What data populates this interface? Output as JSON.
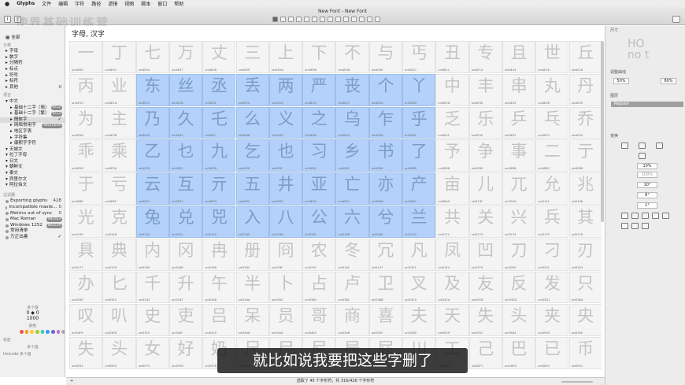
{
  "menubar": {
    "app": "Glyphs",
    "items": [
      "文件",
      "编辑",
      "字符",
      "路径",
      "滤镜",
      "视图",
      "脚本",
      "窗口",
      "帮助"
    ]
  },
  "window": {
    "title": "New Font - New Font"
  },
  "watermark": "使界基础训练营",
  "sidebar": {
    "all": "全部",
    "category_header": "分类",
    "categories": [
      {
        "label": "字母"
      },
      {
        "label": "数字"
      },
      {
        "label": "分隔符"
      },
      {
        "label": "标点"
      },
      {
        "label": "符号"
      },
      {
        "label": "标符"
      },
      {
        "label": "其他",
        "count": "0"
      }
    ],
    "language_header": "语言",
    "languages": [
      {
        "label": "中文",
        "indent": 0
      },
      {
        "label": "基础十二字（简）",
        "indent": 1,
        "count": "4/12"
      },
      {
        "label": "基础十二字（繁）",
        "indent": 1,
        "count": "0/12"
      },
      {
        "label": "簡体字",
        "indent": 1,
        "check": "✓",
        "selected": true
      },
      {
        "label": "网络常用字",
        "indent": 1,
        "count": "36/21656"
      },
      {
        "label": "地区字表",
        "indent": 1
      },
      {
        "label": "字符集",
        "indent": 1
      },
      {
        "label": "康熙字字符",
        "indent": 1
      },
      {
        "label": "天城文",
        "indent": 0
      },
      {
        "label": "拉丁字母",
        "indent": 0
      },
      {
        "label": "日文",
        "indent": 0
      },
      {
        "label": "朝鲜文",
        "indent": 0
      },
      {
        "label": "泰文",
        "indent": 0
      },
      {
        "label": "西里尔文",
        "indent": 0
      },
      {
        "label": "阿拉伯文",
        "indent": 0
      }
    ],
    "filter_header": "过滤器",
    "filters": [
      {
        "label": "Exporting glyphs",
        "value": "428"
      },
      {
        "label": "Incompatible maste...",
        "value": "0"
      },
      {
        "label": "Metrics out of sync",
        "value": "0"
      },
      {
        "label": "Mac Roman",
        "count": "94/243"
      },
      {
        "label": "Windows 1252",
        "count": "86/216"
      },
      {
        "label": "常用清单",
        "value": ""
      },
      {
        "label": "万正出書",
        "check": "✓"
      }
    ],
    "bottom": {
      "layers_label": "多个值",
      "value_a": "0",
      "value_b": "0",
      "width_value": "1000",
      "color_label": "颜色",
      "tags_label": "标签",
      "tags_value": "多个值",
      "unicode_label": "Unicode",
      "unicode_value": "多个值",
      "swatch_colors": [
        "#e55",
        "#f90",
        "#fc3",
        "#9c3",
        "#3c9",
        "#39f",
        "#66c",
        "#c6c",
        "#aaa"
      ]
    }
  },
  "main": {
    "title": "字母, 汉字",
    "rows": [
      {
        "glyphs": "一丁七万丈三上下不与丐丑专且世丘",
        "names": [
          "uni4E00",
          "uni4E01",
          "uni4E03",
          "uni4E07",
          "uni4E08",
          "uni4E09",
          "uni4E0A",
          "uni4E0B",
          "uni4E0D",
          "uni4E0E",
          "uni4E10",
          "uni4E11",
          "uni4E13",
          "uni4E14",
          "uni4E16",
          "uni4E18"
        ],
        "sel": []
      },
      {
        "glyphs": "丙业东丝丞丢两严丧个丫中丰串丸丹",
        "names": [
          "uni4E19",
          "uni4E1A",
          "uni4E1C",
          "uni4E1D",
          "uni4E1E",
          "uni4E22",
          "uni4E24",
          "uni4E25",
          "uni4E27",
          "uni4E2A",
          "uni4E2B",
          "uni4E2D",
          "uni4E30",
          "uni4E32",
          "uni4E38",
          "uni4E39"
        ],
        "sel": [
          2,
          3,
          4,
          5,
          6,
          7,
          8,
          9,
          10
        ]
      },
      {
        "glyphs": "为主乃久乇么义之乌乍乎乏乐乒乓乔",
        "names": [
          "uni4E3A",
          "uni4E3B",
          "uni4E43",
          "uni4E45",
          "uni4E47",
          "uni4E48",
          "uni4E49",
          "uni4E4B",
          "uni4E4C",
          "uni4E4D",
          "uni4E4E",
          "uni4E4F",
          "uni4E50",
          "uni4E52",
          "uni4E53",
          "uni4E54"
        ],
        "sel": [
          2,
          3,
          4,
          5,
          6,
          7,
          8,
          9,
          10
        ]
      },
      {
        "glyphs": "乖乘乙乜九乞也习乡书了予争事二亍",
        "names": [
          "uni4E56",
          "uni4E58",
          "uni4E59",
          "uni4E5C",
          "uni4E5D",
          "uni4E5E",
          "uni4E5F",
          "uni4E60",
          "uni4E61",
          "uni4E66",
          "uni4E86",
          "uni4E88",
          "uni4E89",
          "uni4E8B",
          "uni4E8C",
          "uni4E8D"
        ],
        "sel": [
          2,
          3,
          4,
          5,
          6,
          7,
          8,
          9,
          10
        ]
      },
      {
        "glyphs": "于亏云互亓五井亚亡亦产亩儿兀允兆",
        "names": [
          "uni4E8E",
          "uni4E8F",
          "uni4E91",
          "uni4E92",
          "uni4E93",
          "uni4E94",
          "uni4E95",
          "uni4E9A",
          "uni4EA1",
          "uni4EA6",
          "uni4EA7",
          "uni4EA9",
          "uni513F",
          "uni5140",
          "uni5141",
          "uni5146"
        ],
        "sel": [
          2,
          3,
          4,
          5,
          6,
          7,
          8,
          9,
          10
        ]
      },
      {
        "glyphs": "光克兔兑兕入八公六兮兰共关兴兵其",
        "names": [
          "uni5149",
          "uni514B",
          "uni5154",
          "uni5151",
          "uni5155",
          "uni5165",
          "uni516B",
          "uni516C",
          "uni516D",
          "uni516E",
          "uni5170",
          "uni5171",
          "uni5173",
          "uni5174",
          "uni5175",
          "uni5176"
        ],
        "sel": [
          2,
          3,
          4,
          5,
          6,
          7,
          8,
          9,
          10
        ]
      },
      {
        "glyphs": "具典内冈冉册冏农冬冗凡凤凹刀刁刃",
        "names": [
          "uni5177",
          "uni5178",
          "uni5185",
          "uni5188",
          "uni5189",
          "uni518C",
          "uni518F",
          "uni519C",
          "uni51AC",
          "uni5197",
          "uni51E1",
          "uni51E4",
          "uni51F9",
          "uni5200",
          "uni5201",
          "uni5203"
        ],
        "sel": []
      },
      {
        "glyphs": "办匕千升午半卜占卢卫叉及友反发只",
        "names": [
          "uni529E",
          "uni5315",
          "uni5343",
          "uni5347",
          "uni5348",
          "uni534A",
          "uni535C",
          "uni5360",
          "uni5362",
          "uni536B",
          "uni53C9",
          "uni53CA",
          "uni53CB",
          "uni53CD",
          "uni53D1",
          "uni53EA"
        ],
        "sel": []
      },
      {
        "glyphs": "叹叭史吏吕呆员哥商喜夫天失头夹央",
        "names": [
          "uni53F9",
          "uni53ED",
          "uni53F2",
          "uni540F",
          "uni5415",
          "uni5446",
          "uni5458",
          "uni54E5",
          "uni5546",
          "uni559C",
          "uni592B",
          "uni5929",
          "uni5931",
          "uni5934",
          "uni5939",
          "uni592E"
        ],
        "sel": []
      },
      {
        "glyphs": "失头女好奶尺尸尼局屁川工己巴已币",
        "names": [
          "uni5931",
          "uni5934",
          "uni5973",
          "uni597D",
          "uni5976",
          "uni5C3A",
          "uni5C38",
          "uni5C3C",
          "uni5C40",
          "uni5C41",
          "uni5DDD",
          "uni5DE5",
          "uni5DF1",
          "uni5DF4",
          "uni5DF2",
          "uni5E01"
        ],
        "sel": []
      }
    ]
  },
  "status": {
    "text": "选取了 45 个字形符，共 316/426 个字形符",
    "plus": "+"
  },
  "inspector": {
    "size_label": "尺寸",
    "preview_line1": "HO",
    "preview_line2": "no  t",
    "metrics_label": "调整曲线",
    "metric_left": "50%",
    "metric_right": "80%",
    "master_label": "图层",
    "master_value": "Regular",
    "transform_label": "变换",
    "scale_value": "10%",
    "scale_value2": "100%",
    "rotate_value": "10°",
    "slant_value": "8°",
    "extra_value": "1°"
  },
  "subtitle": "就比如说我要把这些字删了"
}
